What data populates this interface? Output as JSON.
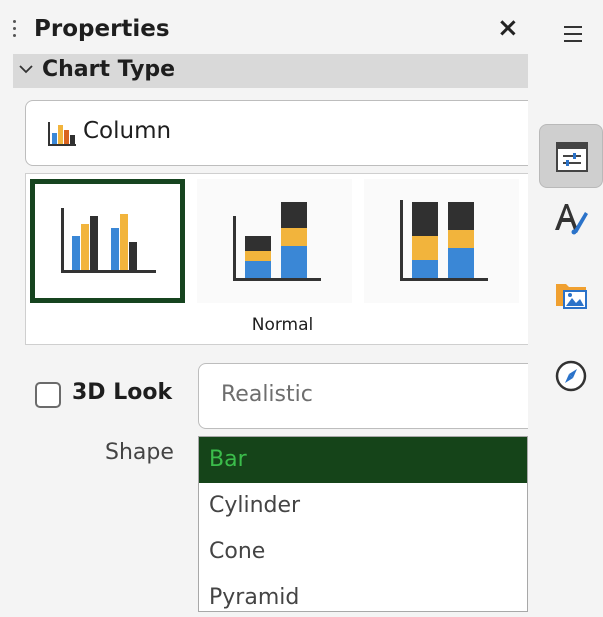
{
  "panel": {
    "title": "Properties",
    "close_label": "×",
    "icons": {
      "grip": "grip-dots-icon",
      "close": "close-icon"
    }
  },
  "section": {
    "label": "Chart Type",
    "icon": "chevron-down-icon"
  },
  "chart_type": {
    "value": "Column",
    "icon": "column-chart-icon"
  },
  "variants": {
    "caption": "Normal",
    "items": [
      {
        "name": "normal",
        "selected": true
      },
      {
        "name": "stacked",
        "selected": false
      },
      {
        "name": "percent-stacked",
        "selected": false
      }
    ]
  },
  "look_3d": {
    "label": "3D Look",
    "checked": false,
    "scheme_value": "Realistic"
  },
  "shape": {
    "label": "Shape",
    "options": [
      "Bar",
      "Cylinder",
      "Cone",
      "Pyramid"
    ],
    "selected": "Bar"
  },
  "tabbar": {
    "menu_icon": "hamburger-menu-icon",
    "tabs": [
      {
        "icon": "properties-icon",
        "active": true
      },
      {
        "icon": "styles-icon",
        "active": false
      },
      {
        "icon": "gallery-icon",
        "active": false
      },
      {
        "icon": "navigator-icon",
        "active": false
      }
    ]
  },
  "colors": {
    "selected_green": "#154419",
    "selected_text": "#3bbd4b",
    "bar_blue": "#3a87d6",
    "bar_orange": "#f2b43c",
    "bar_dark": "#303030"
  }
}
